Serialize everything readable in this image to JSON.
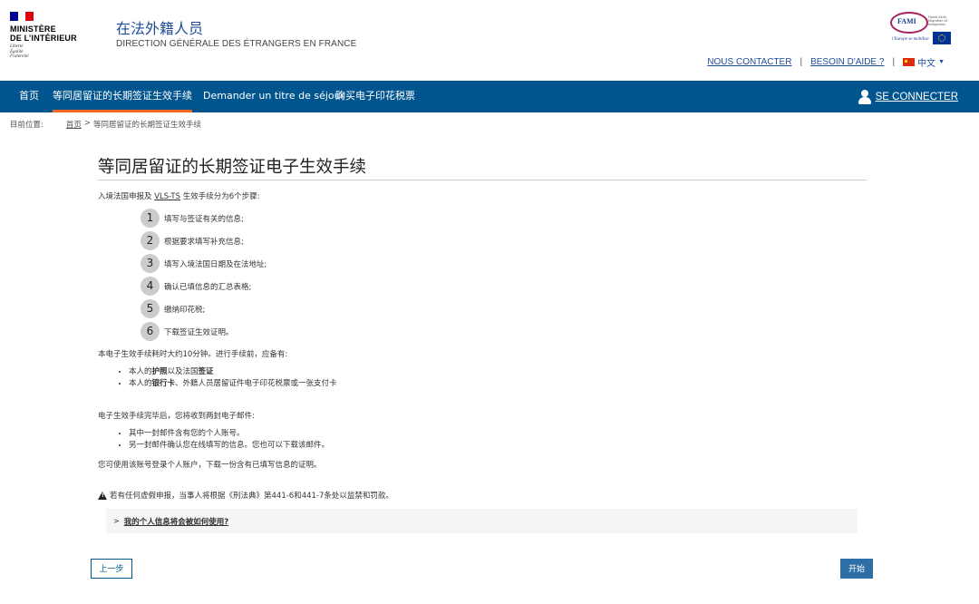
{
  "header": {
    "ministry_lines": [
      "MINISTÈRE",
      "DE L’INTÉRIEUR"
    ],
    "devise_lines": [
      "Liberté",
      "Égalité",
      "Fraternité"
    ],
    "site_title": "在法外籍人员",
    "site_subtitle": "DIRECTION GÉNÉRALE DES ÉTRANGERS EN FRANCE",
    "fami": {
      "word": "FAMI",
      "small": "Fonds Asile, Migration et Intégration",
      "slogan": "l'Europe se mobilise"
    },
    "links": {
      "contact": "NOUS CONTACTER",
      "help": "BESOIN D'AIDE ?",
      "separator": "|",
      "language": "中文"
    }
  },
  "nav": {
    "items": [
      {
        "label": "首页"
      },
      {
        "label": "等同居留证的长期签证生效手续"
      },
      {
        "label": "Demander un titre de séjour"
      },
      {
        "label": "购买电子印花税票"
      }
    ],
    "connect_label": "SE CONNECTER"
  },
  "breadcrumb": {
    "label": "目前位置:",
    "home": "首页",
    "separator": ">",
    "current": "等同居留证的长期签证生效手续"
  },
  "main": {
    "title": "等同居留证的长期签证电子生效手续",
    "intro_before": "入境法国申报及 ",
    "intro_abbr": "VLS-TS",
    "intro_after": " 生效手续分为6个步骤:",
    "steps": [
      {
        "num": "1",
        "label": "填写与签证有关的信息;"
      },
      {
        "num": "2",
        "label": "根据要求填写补充信息;"
      },
      {
        "num": "3",
        "label": "填写入境法国日期及在法地址;"
      },
      {
        "num": "4",
        "label": "确认已填信息的汇总表格;"
      },
      {
        "num": "5",
        "label": "缴纳印花税;"
      },
      {
        "num": "6",
        "label": "下载签证生效证明。"
      }
    ],
    "duration_text": "本电子生效手续耗时大约10分钟。进行手续前，应备有:",
    "prepare": [
      {
        "pre": "本人的",
        "b1": "护照",
        "mid": "以及法国",
        "b2": "签证",
        "post": ""
      },
      {
        "pre": "本人的",
        "b1": "银行卡",
        "mid": "、外籍人员居留证件电子印花税票或一张支付卡",
        "b2": "",
        "post": ""
      }
    ],
    "after_text": "电子生效手续完毕后，您将收到两封电子邮件:",
    "emails": [
      "其中一封邮件含有您的个人账号。",
      "另一封邮件确认您在线填写的信息。您也可以下载该邮件。"
    ],
    "login_text": "您可使用该账号登录个人账户，下载一份含有已填写信息的证明。",
    "warning": "若有任何虚假申报，当事人将根据《刑法典》第441-6和441-7条处以监禁和罚款。",
    "accordion_chevron": ">",
    "accordion_label": "我的个人信息将会被如何使用?"
  },
  "buttons": {
    "prev": "上一步",
    "start": "开始"
  },
  "colors": {
    "nav_bg": "#00558f",
    "nav_active_underline": "#f26522",
    "title_blue": "#1f4d9a",
    "start_button": "#2f6fa7"
  }
}
